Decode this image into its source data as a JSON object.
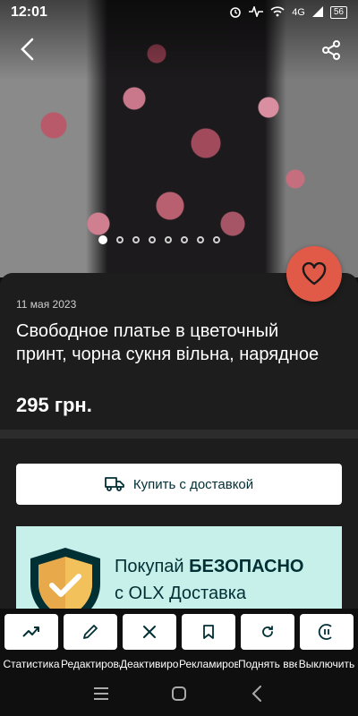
{
  "status": {
    "time": "12:01",
    "network": "4G",
    "battery": "56"
  },
  "gallery": {
    "image_count": 8,
    "active_index": 0
  },
  "listing": {
    "date": "11 мая 2023",
    "title": "Свободное платье в цветочный принт, чорна сукня вільна, нарядное",
    "price": "295 грн."
  },
  "buy_button": {
    "label": "Купить с доставкой"
  },
  "banner": {
    "line1_normal": "Покупай ",
    "line1_bold": "БЕЗОПАСНО",
    "line2": "с OLX Доставка"
  },
  "actions": [
    {
      "label": "Статистика",
      "icon": "trend-up-icon"
    },
    {
      "label": "Редактировать",
      "icon": "pencil-icon"
    },
    {
      "label": "Деактивировать",
      "icon": "close-icon"
    },
    {
      "label": "Рекламировать",
      "icon": "bookmark-icon"
    },
    {
      "label": "Поднять вверх",
      "icon": "refresh-icon"
    },
    {
      "label": "Выключить",
      "icon": "pause-icon"
    }
  ],
  "colors": {
    "accent": "#e05a47",
    "dark_teal": "#002f34",
    "banner_bg": "#c8f0ea",
    "card_bg": "#1d1d1d"
  }
}
